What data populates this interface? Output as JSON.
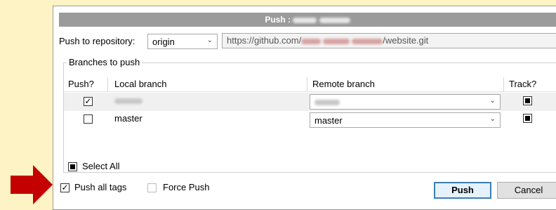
{
  "dialog": {
    "title_prefix": "Push :",
    "repo_label": "Push to repository:",
    "repo_value": "origin",
    "url_prefix": "https://github.com/",
    "url_suffix": "/website.git",
    "group_title": "Branches to push",
    "columns": {
      "push": "Push?",
      "local": "Local branch",
      "remote": "Remote branch",
      "track": "Track?"
    },
    "rows": [
      {
        "push_checked": true,
        "local": "",
        "remote": "",
        "tracked": true
      },
      {
        "push_checked": false,
        "local": "master",
        "remote": "master",
        "tracked": true
      }
    ],
    "select_all_label": "Select All",
    "push_all_tags_label": "Push all tags",
    "push_all_tags_checked": true,
    "force_push_label": "Force Push",
    "force_push_checked": false,
    "push_button": "Push",
    "cancel_button": "Cancel"
  },
  "colors": {
    "annotation_arrow": "#c40000",
    "background": "#fdf3c4",
    "titlebar": "#9b9b9b"
  }
}
